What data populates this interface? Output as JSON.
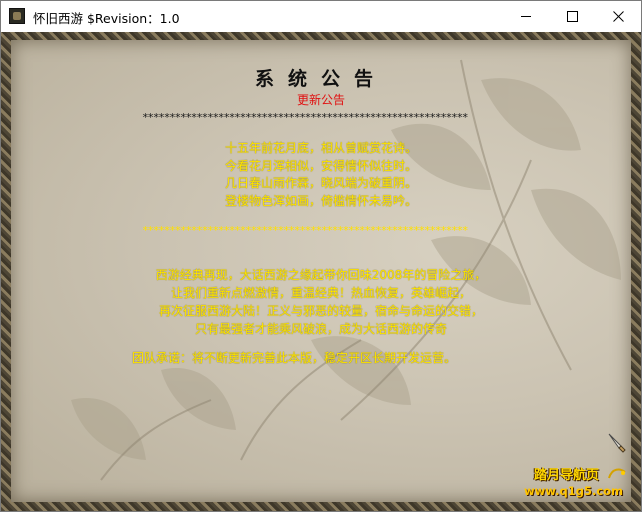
{
  "window": {
    "title": "怀旧西游 $Revision：1.0"
  },
  "notice": {
    "heading": "系统公告",
    "subheading": "更新公告",
    "separator_top": "************************************************************",
    "poem": [
      "十五年前花月底，相从曾赋赏花诗。",
      "今看花月浑相似，安得情怀似往时。",
      "几日春山雨作霖，晓风端为破重阴。",
      "登楼物色浑如画，倚槛情怀未易吟。"
    ],
    "separator_mid": "************************************************************",
    "paragraph": [
      "西游经典再现，大话西游之缘起带你回味2008年的冒险之旅，",
      "让我们重新点燃激情，重温经典！热血恢复，英雄崛起，",
      "再次征服西游大陆！正义与邪恶的较量，宿命与命运的交错，",
      "只有最强者才能乘风破浪，成为大话西游的传奇"
    ],
    "team_pledge": "团队承诺：将不断更新完善此本版，稳定开区长期开发运营。"
  },
  "badge": {
    "name": "踏月导航页",
    "url": "www.q1g5.com"
  },
  "colors": {
    "poem_text": "#ffe600",
    "subheading": "#e01010",
    "heading": "#111111"
  },
  "icons": {
    "app": "app-icon",
    "minimize": "minimize-icon",
    "maximize": "maximize-icon",
    "close": "close-icon",
    "brush": "brush-icon"
  }
}
